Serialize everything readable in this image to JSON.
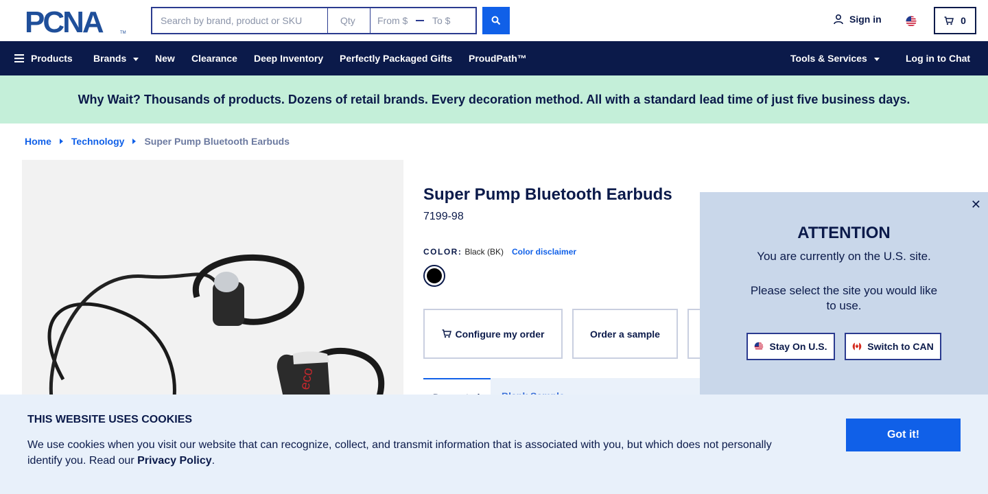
{
  "header": {
    "logo_text": "PCNA",
    "search_placeholder": "Search by brand, product or SKU",
    "qty_placeholder": "Qty",
    "from_placeholder": "From $",
    "to_placeholder": "To $",
    "sign_in_label": "Sign in",
    "cart_count": "0"
  },
  "nav": {
    "products": "Products",
    "brands": "Brands",
    "new": "New",
    "clearance": "Clearance",
    "deep_inventory": "Deep Inventory",
    "perfectly_packaged": "Perfectly Packaged Gifts",
    "proudpath": "ProudPath™",
    "tools": "Tools & Services",
    "chat": "Log in to Chat"
  },
  "banner": {
    "text": "Why Wait? Thousands of products. Dozens of retail brands. Every decoration method. All with a standard lead time of just five business days."
  },
  "breadcrumb": {
    "home": "Home",
    "category": "Technology",
    "current": "Super Pump Bluetooth Earbuds"
  },
  "product": {
    "title": "Super Pump Bluetooth Earbuds",
    "sku": "7199-98",
    "color_label": "COLOR:",
    "color_value": "Black (BK)",
    "color_disclaimer": "Color disclaimer",
    "swatch_color": "#000000",
    "image_brand_text": "eco"
  },
  "actions": {
    "configure": "Configure my order",
    "sample": "Order a sample"
  },
  "tabs": {
    "active": "Decorated",
    "other": "Blank Sample"
  },
  "modal": {
    "heading": "ATTENTION",
    "line1": "You are currently on the U.S. site.",
    "line2": "Please select the site you would like to use.",
    "stay_button": "Stay On U.S.",
    "switch_button": "Switch to CAN"
  },
  "cookie": {
    "heading": "THIS WEBSITE USES COOKIES",
    "body": "We use cookies when you visit our website that can recognize, collect, and transmit information that is associated with you, but which does not personally identify you. Read our",
    "link": "Privacy Policy",
    "period": ".",
    "button": "Got it!"
  },
  "colors": {
    "navy": "#0b1a4a",
    "accent": "#1060e8",
    "banner_bg": "#c4efd9",
    "modal_bg": "#c9d7ea",
    "cookie_bg": "#e8f0fa"
  }
}
